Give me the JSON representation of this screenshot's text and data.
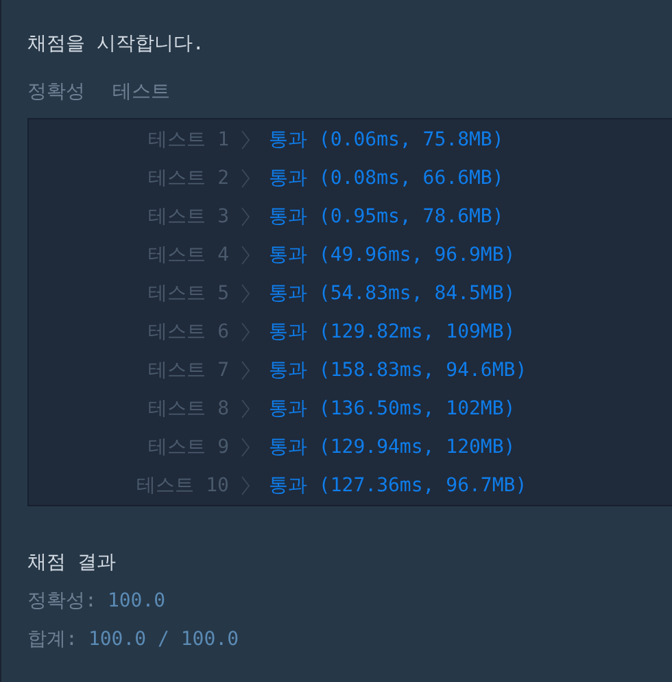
{
  "heading": "채점을 시작합니다.",
  "section": {
    "title": "정확성",
    "subtitle": "테스트"
  },
  "tests": [
    {
      "name": "테스트 1",
      "result": "통과 (0.06ms, 75.8MB)"
    },
    {
      "name": "테스트 2",
      "result": "통과 (0.08ms, 66.6MB)"
    },
    {
      "name": "테스트 3",
      "result": "통과 (0.95ms, 78.6MB)"
    },
    {
      "name": "테스트 4",
      "result": "통과 (49.96ms, 96.9MB)"
    },
    {
      "name": "테스트 5",
      "result": "통과 (54.83ms, 84.5MB)"
    },
    {
      "name": "테스트 6",
      "result": "통과 (129.82ms, 109MB)"
    },
    {
      "name": "테스트 7",
      "result": "통과 (158.83ms, 94.6MB)"
    },
    {
      "name": "테스트 8",
      "result": "통과 (136.50ms, 102MB)"
    },
    {
      "name": "테스트 9",
      "result": "통과 (129.94ms, 120MB)"
    },
    {
      "name": "테스트 10",
      "result": "통과 (127.36ms, 96.7MB)"
    }
  ],
  "summary": {
    "title": "채점 결과",
    "lines": [
      {
        "label": "정확성:",
        "value": "100.0"
      },
      {
        "label": "합계:",
        "value": "100.0 / 100.0"
      }
    ]
  }
}
